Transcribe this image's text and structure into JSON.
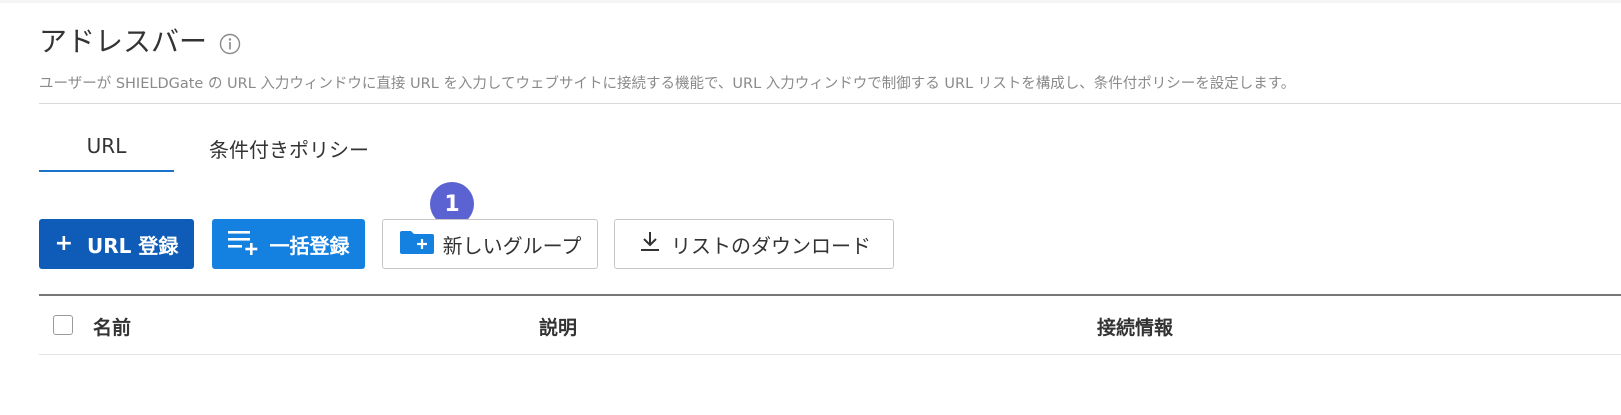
{
  "page": {
    "title": "アドレスバー",
    "description": "ユーザーが SHIELDGate の URL 入力ウィンドウに直接 URL を入力してウェブサイトに接続する機能で、URL 入力ウィンドウで制御する URL リストを構成し、条件付ポリシーを設定します。"
  },
  "tabs": [
    {
      "label": "URL",
      "active": true
    },
    {
      "label": "条件付きポリシー",
      "active": false
    }
  ],
  "toolbar": {
    "url_register_label": "URL 登録",
    "bulk_register_label": "一括登録",
    "new_group_label": "新しいグループ",
    "download_list_label": "リストのダウンロード"
  },
  "callout": {
    "number": "1"
  },
  "table": {
    "columns": [
      "名前",
      "説明",
      "接続情報"
    ]
  },
  "colors": {
    "primary_dark": "#0e5bb8",
    "primary": "#1480e0",
    "tab_underline": "#1a73c9",
    "callout": "#5b63d3"
  },
  "icons": [
    "info-icon",
    "plus-icon",
    "list-add-icon",
    "folder-plus-icon",
    "download-icon",
    "checkbox-icon"
  ]
}
